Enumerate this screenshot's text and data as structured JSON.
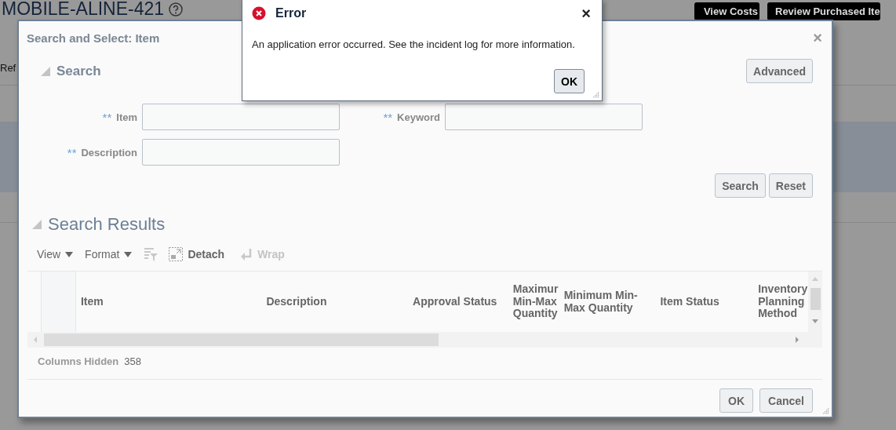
{
  "background_page": {
    "title": "MOBILE-ALINE-421",
    "side_label": "Ref",
    "buttons": [
      "View Costs",
      "Review Purchased Ite"
    ]
  },
  "search_dialog": {
    "title": "Search and Select: Item",
    "close": "×",
    "search_section": {
      "title": "Search",
      "expanded": true,
      "advanced_button": "Advanced",
      "fields": [
        {
          "marker": "**",
          "label": "Item"
        },
        {
          "marker": "**",
          "label": "Keyword"
        },
        {
          "marker": "**",
          "label": "Description"
        }
      ],
      "buttons": [
        "Search",
        "Reset"
      ]
    },
    "results_section": {
      "title": "Search Results",
      "expanded": true,
      "toolbar": [
        {
          "kind": "menu",
          "label": "View",
          "disabled": false
        },
        {
          "kind": "menu",
          "label": "Format",
          "disabled": false
        },
        {
          "kind": "icon",
          "disabled": true
        },
        {
          "kind": "detach",
          "label": "Detach",
          "disabled": false
        },
        {
          "kind": "wrap",
          "label": "Wrap",
          "disabled": true
        }
      ],
      "table": {
        "columns": [
          "Item",
          "Description",
          "Approval Status",
          "Maximur Min-Max Quantity",
          "Minimum Min-Max Quantity",
          "Item Status",
          "Inventory Planning Method"
        ]
      },
      "columns_hidden": {
        "label": "Columns Hidden",
        "value": "358"
      }
    },
    "buttons": [
      "OK",
      "Cancel"
    ]
  },
  "error_dialog": {
    "title": "Error",
    "close": "×",
    "message": "An application error occurred. See the incident log for more information.",
    "button": "OK"
  }
}
